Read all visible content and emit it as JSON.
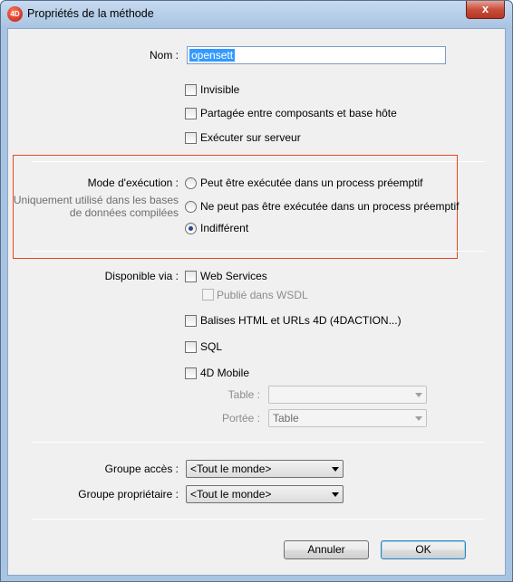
{
  "window": {
    "title": "Propriétés de la méthode",
    "icon_text": "4D",
    "close_label": "x"
  },
  "name": {
    "label": "Nom :",
    "value": "opensett"
  },
  "options": {
    "invisible": "Invisible",
    "shared": "Partagée entre composants et base hôte",
    "server": "Exécuter sur serveur"
  },
  "exec_mode": {
    "label": "Mode d'exécution :",
    "note_line1": "Uniquement utilisé dans les bases",
    "note_line2": "de données compilées",
    "options": [
      {
        "label": "Peut être exécutée dans un process préemptif",
        "selected": false
      },
      {
        "label": "Ne peut pas être exécutée dans un process préemptif",
        "selected": false
      },
      {
        "label": "Indifférent",
        "selected": true
      }
    ],
    "highlight_color": "#e5481f"
  },
  "available": {
    "label": "Disponible via :",
    "web_services": "Web Services",
    "wsdl": "Publié dans WSDL",
    "html": "Balises HTML et URLs 4D (4DACTION...)",
    "sql": "SQL",
    "mobile": "4D Mobile",
    "table_label": "Table :",
    "table_value": "",
    "scope_label": "Portée :",
    "scope_value": "Table"
  },
  "groups": {
    "access_label": "Groupe accès :",
    "access_value": "<Tout le monde>",
    "owner_label": "Groupe propriétaire :",
    "owner_value": "<Tout le monde>"
  },
  "buttons": {
    "cancel": "Annuler",
    "ok": "OK"
  }
}
